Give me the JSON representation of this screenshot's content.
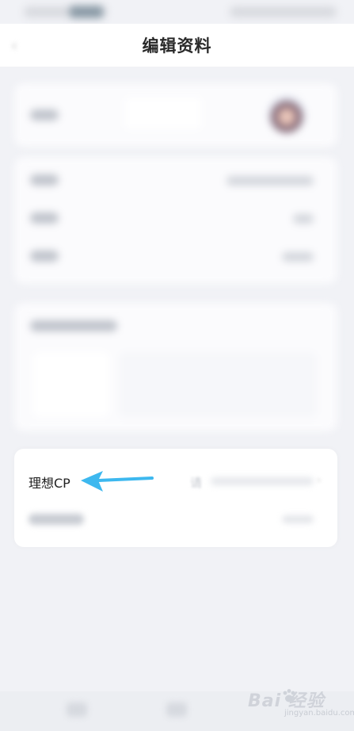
{
  "header": {
    "title": "编辑资料"
  },
  "cp_card": {
    "label": "理想CP",
    "placeholder": "请"
  },
  "annotation": {
    "arrow_color": "#3db8ef"
  },
  "watermark": {
    "brand": "Bai  经验",
    "sub": "jingyan.baidu.com"
  },
  "icons": {
    "back": "back-chevron-icon",
    "row": "chevron-right-icon"
  }
}
